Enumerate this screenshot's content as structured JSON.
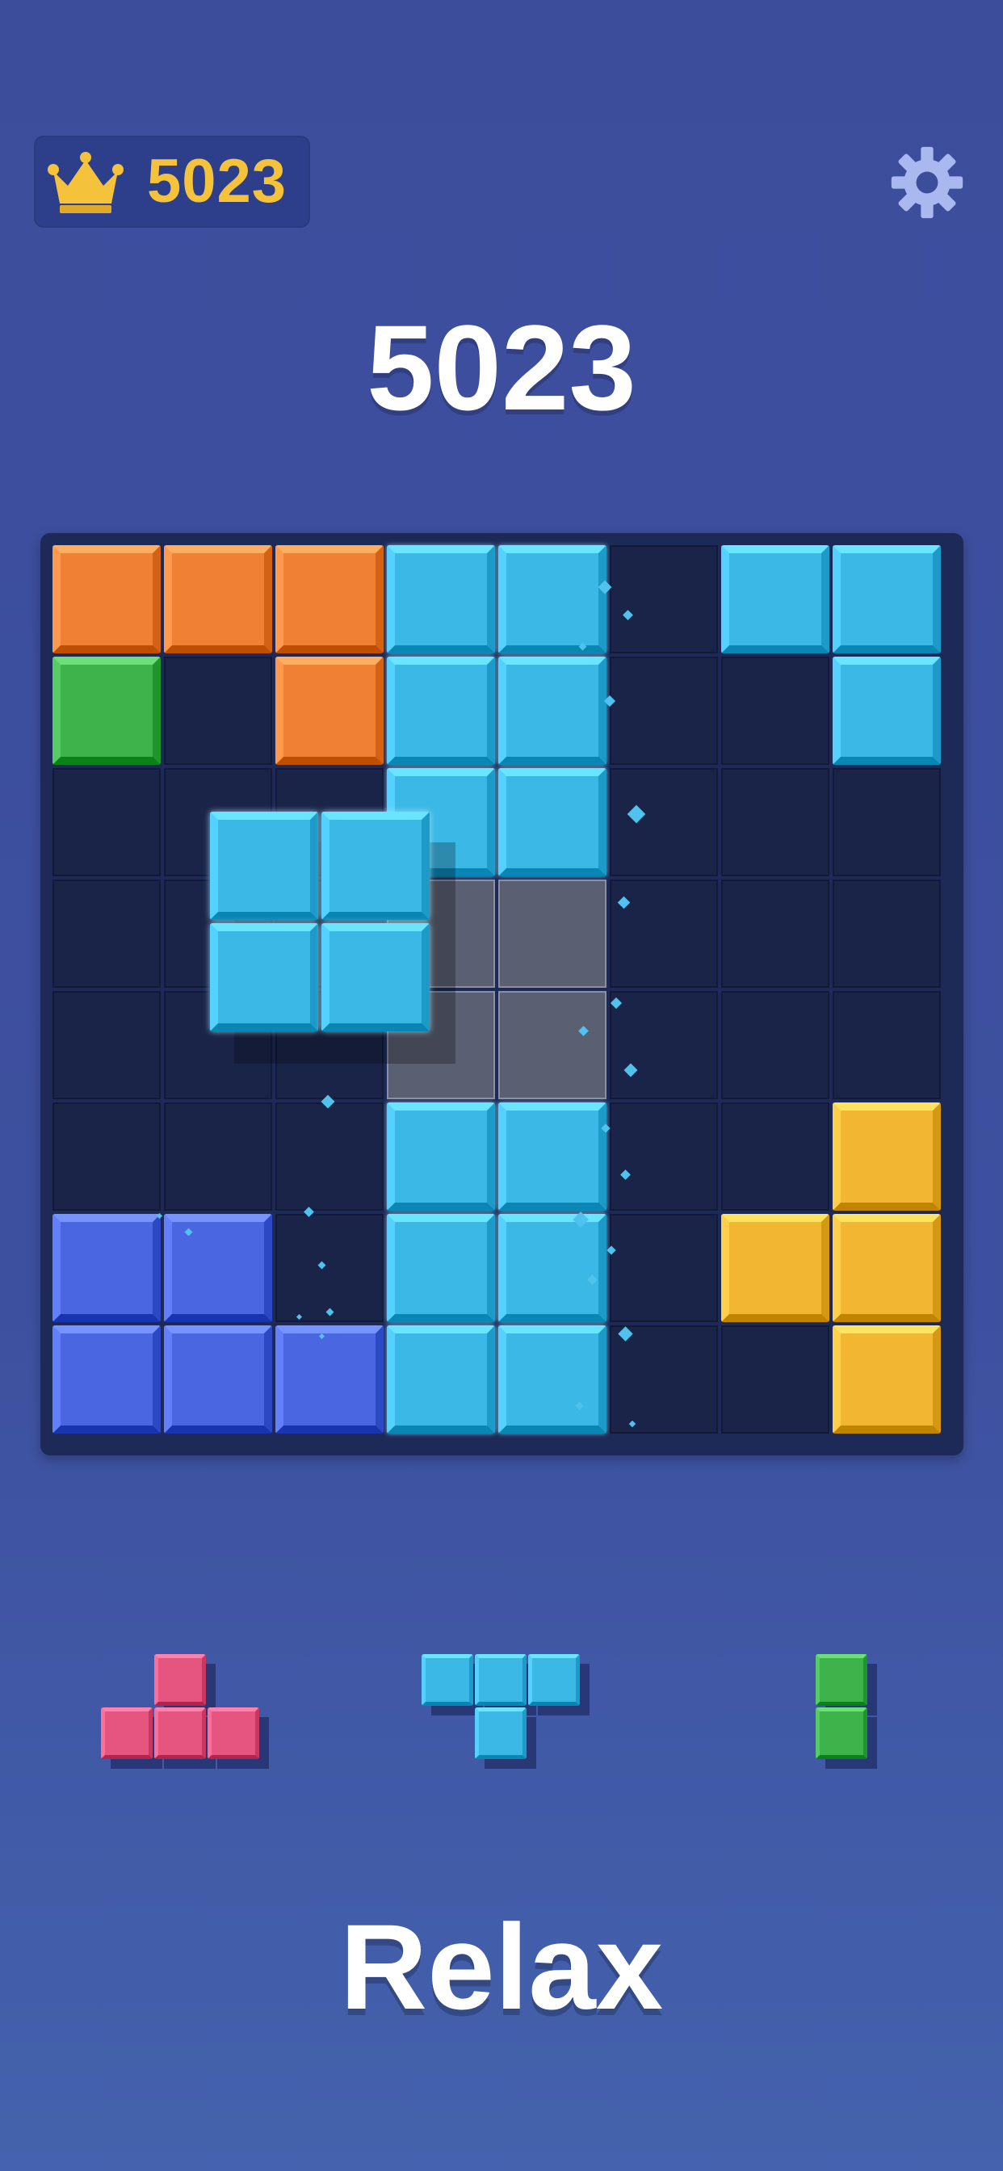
{
  "header": {
    "best_score": "5023",
    "crown_icon": "crown-icon",
    "settings_icon": "gear-icon"
  },
  "score": "5023",
  "colors": {
    "orange": "#f08034",
    "green": "#3fb34b",
    "cyan": "#3cb8e6",
    "blue": "#4a66e0",
    "yellow": "#f2b632",
    "pink": "#e5557f",
    "empty": "#1a2448",
    "board": "#1d2a57"
  },
  "board": {
    "size": 8,
    "rows": [
      [
        "orange",
        "orange",
        "orange",
        "cyan",
        "cyan",
        "empty",
        "cyan",
        "cyan"
      ],
      [
        "green",
        "empty",
        "orange",
        "cyan",
        "cyan",
        "empty",
        "empty",
        "cyan"
      ],
      [
        "empty",
        "empty",
        "empty",
        "cyan",
        "cyan",
        "empty",
        "empty",
        "empty"
      ],
      [
        "empty",
        "empty",
        "empty",
        "ghost",
        "ghost",
        "empty",
        "empty",
        "empty"
      ],
      [
        "empty",
        "empty",
        "empty",
        "ghost",
        "ghost",
        "empty",
        "empty",
        "empty"
      ],
      [
        "empty",
        "empty",
        "empty",
        "cyan",
        "cyan",
        "empty",
        "empty",
        "yellow"
      ],
      [
        "blue",
        "blue",
        "empty",
        "cyan",
        "cyan",
        "empty",
        "yellow",
        "yellow"
      ],
      [
        "blue",
        "blue",
        "blue",
        "cyan",
        "cyan",
        "empty",
        "empty",
        "yellow"
      ]
    ],
    "dragging_piece": {
      "color": "cyan",
      "shape": [
        [
          1,
          1
        ],
        [
          1,
          1
        ]
      ]
    }
  },
  "tray": [
    {
      "name": "pink-t-piece",
      "color": "pink",
      "shape": [
        [
          0,
          1,
          0
        ],
        [
          1,
          1,
          1
        ]
      ]
    },
    {
      "name": "cyan-t-piece",
      "color": "cyan",
      "shape": [
        [
          1,
          1,
          1
        ],
        [
          0,
          1,
          0
        ]
      ]
    },
    {
      "name": "green-vertical-piece",
      "color": "green",
      "shape": [
        [
          1
        ],
        [
          1
        ]
      ]
    }
  ],
  "footer": {
    "mode_label": "Relax"
  }
}
